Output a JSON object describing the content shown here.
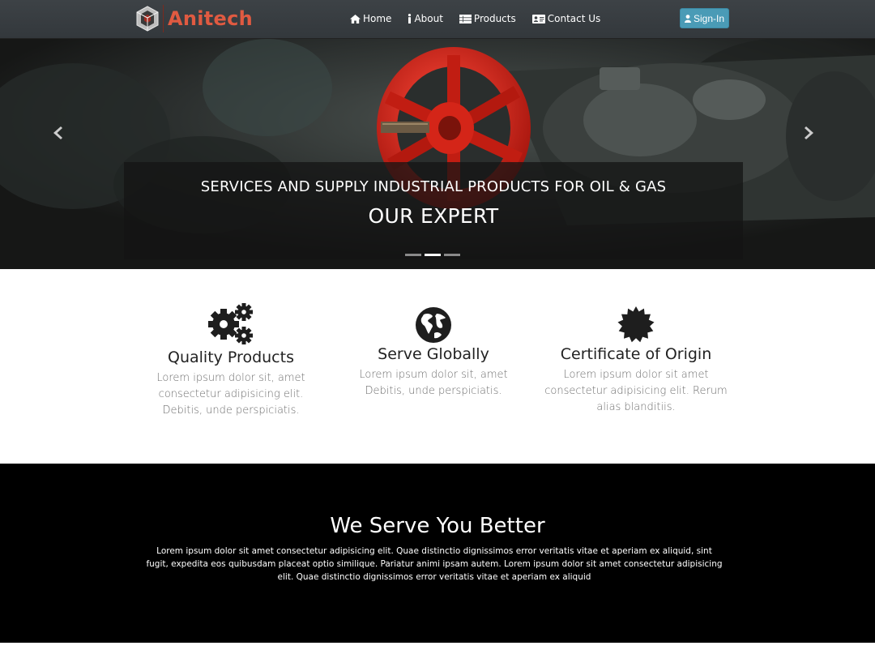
{
  "brand": {
    "name": "Anitech",
    "color": "#e05a41"
  },
  "nav": {
    "items": [
      {
        "label": "Home",
        "icon": "home-icon"
      },
      {
        "label": "About",
        "icon": "info-icon"
      },
      {
        "label": "Products",
        "icon": "list-icon"
      },
      {
        "label": "Contact Us",
        "icon": "contact-card-icon"
      }
    ],
    "signin_label": "Sign-In",
    "signin_icon": "user-icon",
    "signin_color": "#4a9bb6"
  },
  "hero": {
    "subtitle": "SERVICES AND SUPPLY INDUSTRIAL PRODUCTS FOR OIL & GAS",
    "title": "OUR EXPERT",
    "slides": 3,
    "active_slide": 2,
    "prev_icon": "chevron-left-icon",
    "next_icon": "chevron-right-icon"
  },
  "features": [
    {
      "icon": "gears-icon",
      "title": "Quality Products",
      "text": "Lorem ipsum dolor sit, amet consectetur adipisicing elit. Debitis, unde perspiciatis."
    },
    {
      "icon": "globe-icon",
      "title": "Serve Globally",
      "text": "Lorem ipsum dolor sit, amet Debitis, unde perspiciatis."
    },
    {
      "icon": "certificate-icon",
      "title": "Certificate of Origin",
      "text": "Lorem ipsum dolor sit amet consectetur adipisicing elit. Rerum alias blanditiis."
    }
  ],
  "serve": {
    "title": "We Serve You Better",
    "text": "Lorem ipsum dolor sit amet consectetur adipisicing elit. Quae distinctio dignissimos error veritatis vitae et aperiam ex aliquid, sint fugit, expedita eos quibusdam placeat optio similique. Pariatur animi ipsam autem. Lorem ipsum dolor sit amet consectetur adipisicing elit. Quae distinctio dignissimos error veritatis vitae et aperiam ex aliquid"
  }
}
